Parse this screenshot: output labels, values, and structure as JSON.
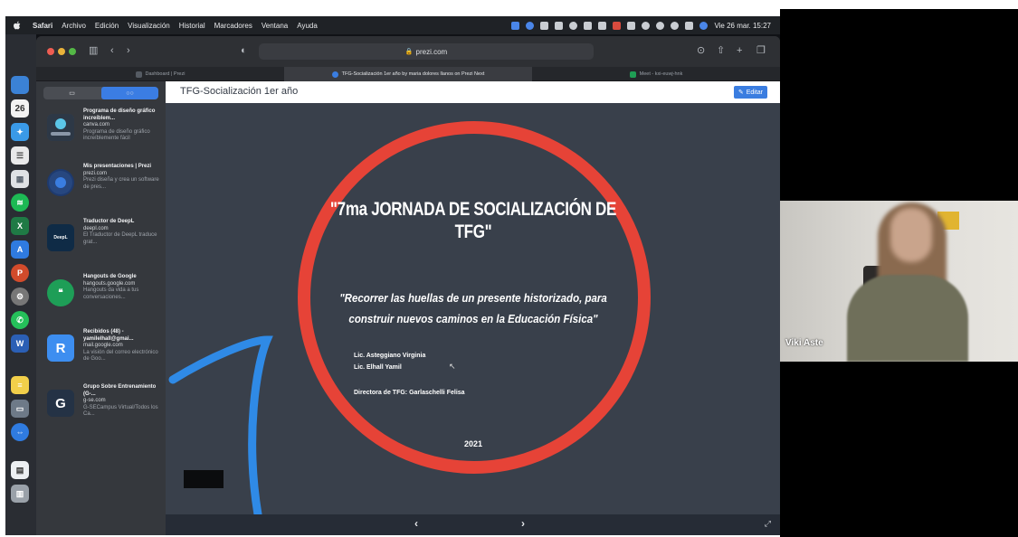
{
  "menubar": {
    "app_name": "Safari",
    "menus": [
      "Archivo",
      "Edición",
      "Visualización",
      "Historial",
      "Marcadores",
      "Ventana",
      "Ayuda"
    ],
    "clock": "Vie 26 mar. 15:27"
  },
  "dock": {
    "calendar_day": "26"
  },
  "browser": {
    "url": "prezi.com",
    "tabs": [
      {
        "label": "Dashboard | Prezi",
        "active": false
      },
      {
        "label": "TFG-Socialización 1er año by maria dolores llanos on Prezi Next",
        "active": true
      },
      {
        "label": "Meet - kxi-euwj-hnk",
        "active": false
      }
    ]
  },
  "sidebar": {
    "items": [
      {
        "title": "Programa de diseño gráfico increíblem...",
        "url": "canva.com",
        "desc": "Programa de diseño gráfico increíblemente fácil"
      },
      {
        "title": "Mis presentaciones | Prezi",
        "url": "prezi.com",
        "desc": "Prezi diseña y crea un software de pres..."
      },
      {
        "title": "Traductor de DeepL",
        "url": "deepl.com",
        "desc": "El Traductor de DeepL traduce grat..."
      },
      {
        "title": "Hangouts de Google",
        "url": "hangouts.google.com",
        "desc": "Hangouts da vida a tus conversaciones..."
      },
      {
        "title": "Recibidos (48) - yamilelhall@gmai...",
        "url": "mail.google.com",
        "desc": "La visión del correo electrónico de Goo..."
      },
      {
        "title": "Grupo Sobre Entrenamiento (G-...",
        "url": "g-se.com",
        "desc": "G-SECampus Virtual/Todos los Ca..."
      }
    ],
    "thumb_letters": [
      "",
      "",
      "",
      "",
      "R",
      "G"
    ],
    "deepl_logo_text": "DeepL"
  },
  "prezi": {
    "header_title": "TFG-Socialización 1er año",
    "edit_label": "Editar",
    "slide": {
      "title": "\"7ma JORNADA DE SOCIALIZACIÓN DE TFG\"",
      "quote": "\"Recorrer las huellas de un presente historizado, para construir nuevos caminos en la Educación Física\"",
      "author1": "Lic. Asteggiano Virginia",
      "author2": "Lic. Elhall Yamil",
      "director": "Directora de TFG: Garlaschelli Felisa",
      "year": "2021"
    },
    "nav_prev": "‹",
    "nav_next": "›"
  },
  "video": {
    "participant_name": "Viki Aste"
  },
  "colors": {
    "slide_bg": "#39404b",
    "circle_red": "#e64337",
    "swoosh_blue": "#2f8ae6",
    "accent_blue": "#3a7de0"
  }
}
